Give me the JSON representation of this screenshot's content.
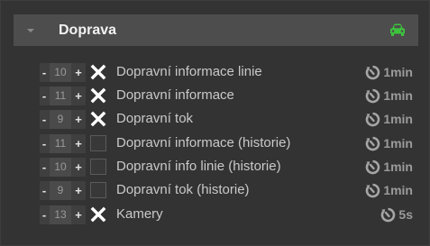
{
  "section": {
    "title": "Doprava",
    "icon": "car-icon",
    "icon_color": "#3cc43c"
  },
  "stepper": {
    "minus": "-",
    "plus": "+"
  },
  "rows": [
    {
      "value": "10",
      "checked": true,
      "label": "Dopravní informace linie",
      "interval": "1min"
    },
    {
      "value": "11",
      "checked": true,
      "label": "Dopravní informace",
      "interval": "1min"
    },
    {
      "value": "9",
      "checked": true,
      "label": "Dopravní tok",
      "interval": "1min"
    },
    {
      "value": "11",
      "checked": false,
      "label": "Dopravní informace (historie)",
      "interval": "1min"
    },
    {
      "value": "10",
      "checked": false,
      "label": "Dopravní info linie (historie)",
      "interval": "1min"
    },
    {
      "value": "9",
      "checked": false,
      "label": "Dopravní tok (historie)",
      "interval": "1min"
    },
    {
      "value": "13",
      "checked": true,
      "label": "Kamery",
      "interval": "5s"
    }
  ]
}
